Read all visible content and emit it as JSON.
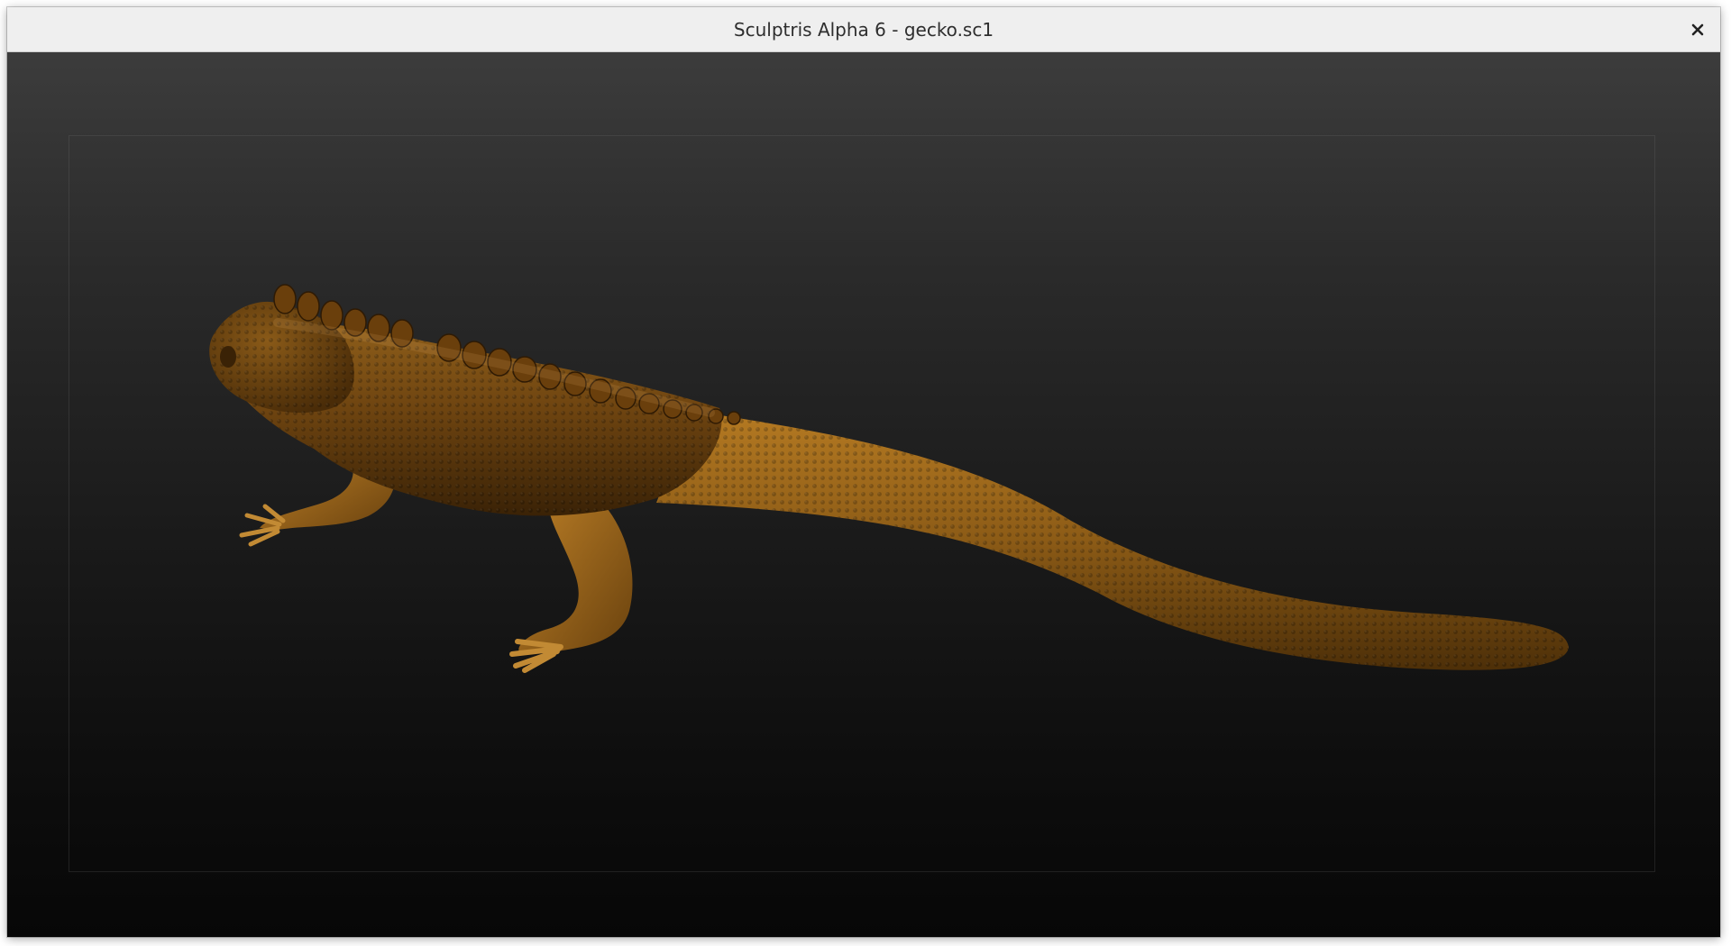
{
  "window": {
    "title": "Sculptris Alpha 6 - gecko.sc1",
    "close_icon": "close-icon"
  },
  "viewport": {
    "model_icon": "gecko-model",
    "model_color": "#8a5a14",
    "background_top": "#3c3c3c",
    "background_bottom": "#070707"
  }
}
